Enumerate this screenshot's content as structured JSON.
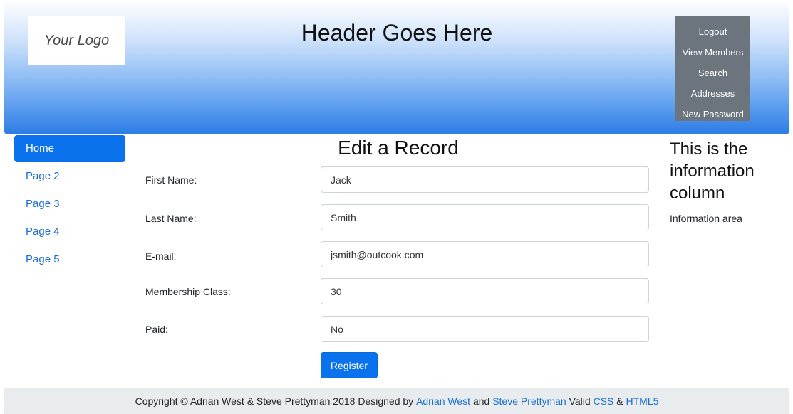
{
  "header": {
    "logo_text": "Your Logo",
    "title": "Header Goes Here",
    "menu": [
      "Logout",
      "View Members",
      "Search",
      "Addresses",
      "New Password"
    ]
  },
  "sidebar": {
    "items": [
      {
        "label": "Home",
        "active": true
      },
      {
        "label": "Page 2",
        "active": false
      },
      {
        "label": "Page 3",
        "active": false
      },
      {
        "label": "Page 4",
        "active": false
      },
      {
        "label": "Page 5",
        "active": false
      }
    ]
  },
  "form": {
    "title": "Edit a Record",
    "fields": [
      {
        "label": "First Name:",
        "value": "Jack"
      },
      {
        "label": "Last Name:",
        "value": "Smith"
      },
      {
        "label": "E-mail:",
        "value": "jsmith@outcook.com"
      },
      {
        "label": "Membership Class:",
        "value": "30"
      },
      {
        "label": "Paid:",
        "value": "No"
      }
    ],
    "submit_label": "Register"
  },
  "info": {
    "heading": "This is the information column",
    "text": "Information area"
  },
  "footer": {
    "copyright": "Copyright © Adrian West & Steve Prettyman 2018 Designed by",
    "author1": "Adrian West",
    "and_text": "and",
    "author2": "Steve Prettyman",
    "valid_text": "Valid",
    "css_link": "CSS",
    "amp": "&",
    "html_link": "HTML5"
  },
  "colors": {
    "accent": "#0b72ee",
    "menu_bg": "#6c757d",
    "footer_bg": "#e9ecef",
    "link": "#1a6fd6"
  }
}
